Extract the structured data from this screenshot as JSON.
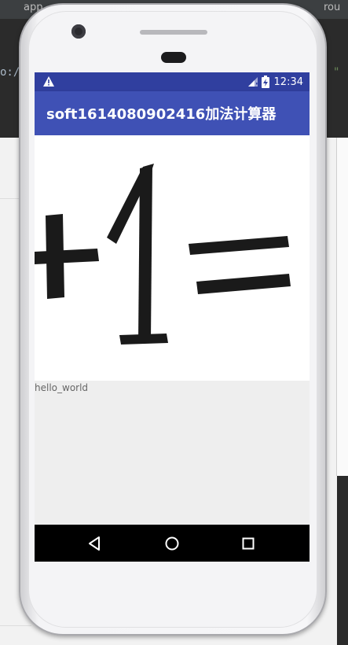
{
  "ide": {
    "tab_label": "app",
    "right_tab_label": "rou",
    "code_fragment_left": "o:/",
    "code_fragment_right": "\""
  },
  "status_bar": {
    "time": "12:34",
    "warning_icon": "warning-icon",
    "signal_icon": "signal-icon",
    "battery_icon": "battery-icon"
  },
  "app_bar": {
    "title": "soft1614080902416加法计算器"
  },
  "image": {
    "description_icon": "handwritten-plus-one-equals-image"
  },
  "content": {
    "hello_text": "hello_world"
  },
  "nav_bar": {
    "back_icon": "back-icon",
    "home_icon": "home-icon",
    "recents_icon": "recents-icon"
  },
  "colors": {
    "status_bar": "#303f9f",
    "app_bar": "#3f51b5",
    "screen_bg": "#eeeeee",
    "nav_bar": "#000000"
  }
}
